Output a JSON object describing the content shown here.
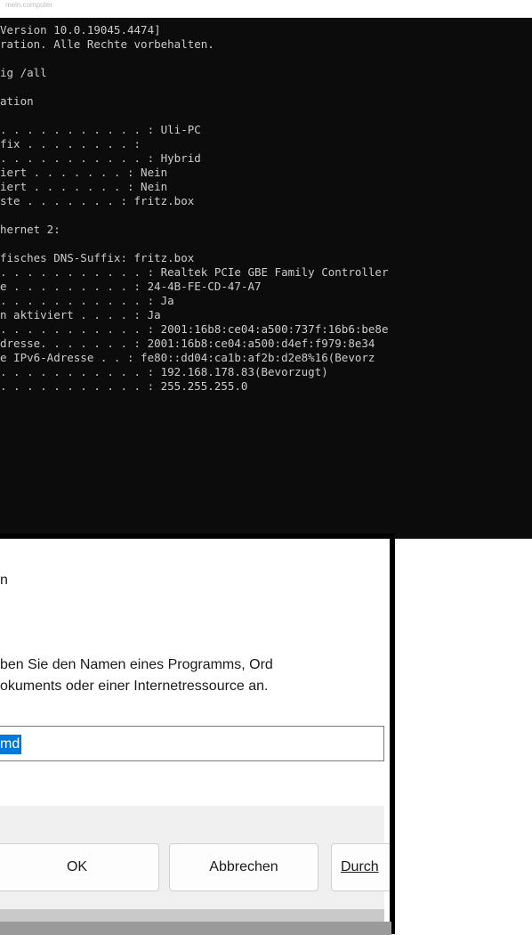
{
  "page": {
    "header_text": "mein.computer"
  },
  "terminal": {
    "lines": [
      "Version 10.0.19045.4474]",
      "ration. Alle Rechte vorbehalten.",
      "",
      "ig /all",
      "",
      "ation",
      "",
      ". . . . . . . . . . . : Uli-PC",
      "fix . . . . . . . . :",
      ". . . . . . . . . . . : Hybrid",
      "iert . . . . . . . : Nein",
      "iert . . . . . . . : Nein",
      "ste . . . . . . . : fritz.box",
      "",
      "hernet 2:",
      "",
      "fisches DNS-Suffix: fritz.box",
      ". . . . . . . . . . . : Realtek PCIe GBE Family Controller",
      "e . . . . . . . . . : 24-4B-FE-CD-47-A7",
      ". . . . . . . . . . . : Ja",
      "n aktiviert . . . . : Ja",
      ". . . . . . . . . . . : 2001:16b8:ce04:a500:737f:16b6:be8e",
      "dresse. . . . . . . : 2001:16b8:ce04:a500:d4ef:f979:8e34",
      "e IPv6-Adresse . . : fe80::dd04:ca1b:af2b:d2e8%16(Bevorz",
      ". . . . . . . . . . . : 192.168.178.83(Bevorzugt)",
      ". . . . . . . . . . . : 255.255.255.0"
    ]
  },
  "run_dialog": {
    "title": "n",
    "description_line1": "ben Sie den Namen eines Programms, Ord",
    "description_line2": "okuments oder einer Internetressource an.",
    "input_value": "md",
    "ok_label": "OK",
    "cancel_label": "Abbrechen",
    "browse_label": "Durch"
  },
  "colors": {
    "terminal_bg": "#0c0c0c",
    "terminal_fg": "#cccccc",
    "selection": "#0078d7"
  }
}
